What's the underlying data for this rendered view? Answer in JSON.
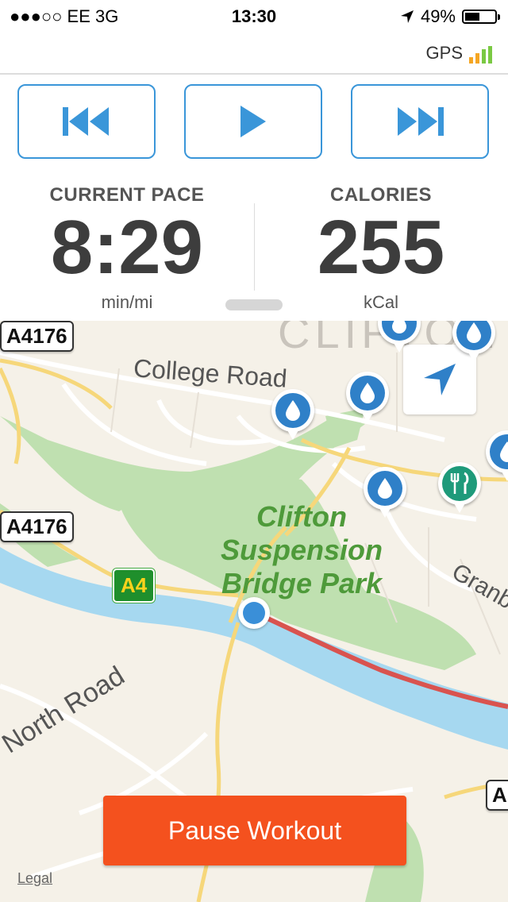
{
  "status_bar": {
    "signal": "●●●○○ EE   3G",
    "time": "13:30",
    "battery": "49%"
  },
  "gps": {
    "label": "GPS",
    "bar_colors": [
      "#f5a623",
      "#f5a623",
      "#7ac943",
      "#7ac943"
    ]
  },
  "controls": {
    "previous_icon": "skip-previous-icon",
    "play_icon": "play-icon",
    "next_icon": "skip-next-icon",
    "accent": "#3a96d9"
  },
  "stats": {
    "pace": {
      "label": "CURRENT PACE",
      "value": "8:29",
      "unit": "min/mi"
    },
    "calories": {
      "label": "CALORIES",
      "value": "255",
      "unit": "kCal"
    }
  },
  "map": {
    "labels": {
      "college_road": "College Road",
      "north_road": "North Road",
      "clifton": "CLIFTON",
      "granby": "Granb",
      "park_line1": "Clifton",
      "park_line2": "Suspension",
      "park_line3": "Bridge Park"
    },
    "shields": {
      "a4176_top": "A4176",
      "a4176_mid": "A4176",
      "a4": "A4",
      "a_right": "A"
    },
    "pins": [
      {
        "type": "water-drop-icon",
        "color": "#2f80c8"
      },
      {
        "type": "water-drop-icon",
        "color": "#2f80c8"
      },
      {
        "type": "water-drop-icon",
        "color": "#2f80c8"
      },
      {
        "type": "water-drop-icon",
        "color": "#2f80c8"
      },
      {
        "type": "water-drop-icon",
        "color": "#2f80c8"
      },
      {
        "type": "water-drop-icon",
        "color": "#2f80c8"
      },
      {
        "type": "fork-knife-icon",
        "color": "#1e9a7a"
      }
    ],
    "legal": "Legal"
  },
  "pause_button": {
    "label": "Pause Workout",
    "color": "#f4511e"
  }
}
